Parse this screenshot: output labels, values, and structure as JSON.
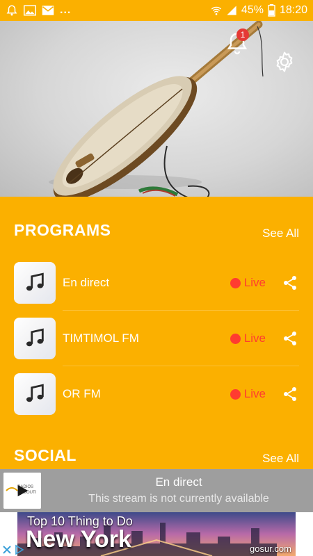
{
  "status_bar": {
    "time": "18:20",
    "battery_percent": "45%",
    "overflow": "...",
    "left_icons": [
      "notification-bell-icon",
      "image-icon",
      "email-icon"
    ],
    "right_icons": [
      "wifi-icon",
      "signal-icon",
      "battery-icon"
    ]
  },
  "header": {
    "notification_count": "1",
    "icons": [
      "bell-icon",
      "gear-icon"
    ]
  },
  "programs": {
    "title": "PROGRAMS",
    "see_all": "See All",
    "items": [
      {
        "name": "En direct",
        "status": "Live"
      },
      {
        "name": "TIMTIMOL FM",
        "status": "Live"
      },
      {
        "name": "OR FM",
        "status": "Live"
      }
    ]
  },
  "social": {
    "title": "SOCIAL",
    "see_all": "See All"
  },
  "player": {
    "title": "En direct",
    "subtitle": "This stream is not currently available"
  },
  "ad": {
    "line1": "Top 10 Thing to Do",
    "line2": "New York",
    "domain": "gosur.com"
  },
  "colors": {
    "accent": "#fbb000",
    "live": "#ff3b30",
    "player_bg": "#9e9e9e",
    "badge": "#e53935"
  }
}
